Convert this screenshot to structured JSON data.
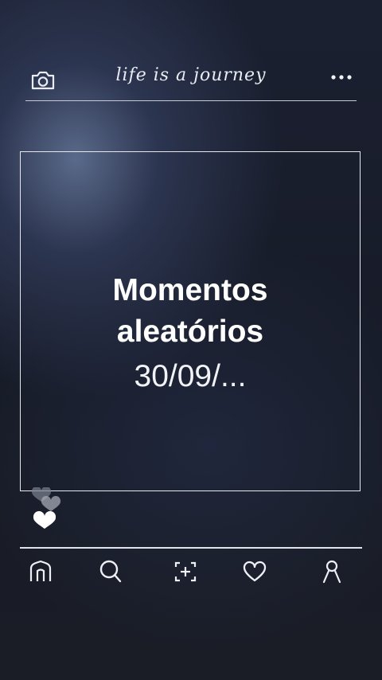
{
  "header": {
    "title": "life is a journey",
    "left_icon": "camera-icon",
    "right_icon": "more-icon"
  },
  "post": {
    "line1": "Momentos",
    "line2": "aleatórios",
    "line3": "30/09/..."
  },
  "nav": [
    "home-icon",
    "search-icon",
    "add-icon",
    "heart-icon",
    "profile-icon"
  ],
  "colors": {
    "background": "#1b2031",
    "line": "#e6e8ee",
    "text": "#ffffff"
  }
}
